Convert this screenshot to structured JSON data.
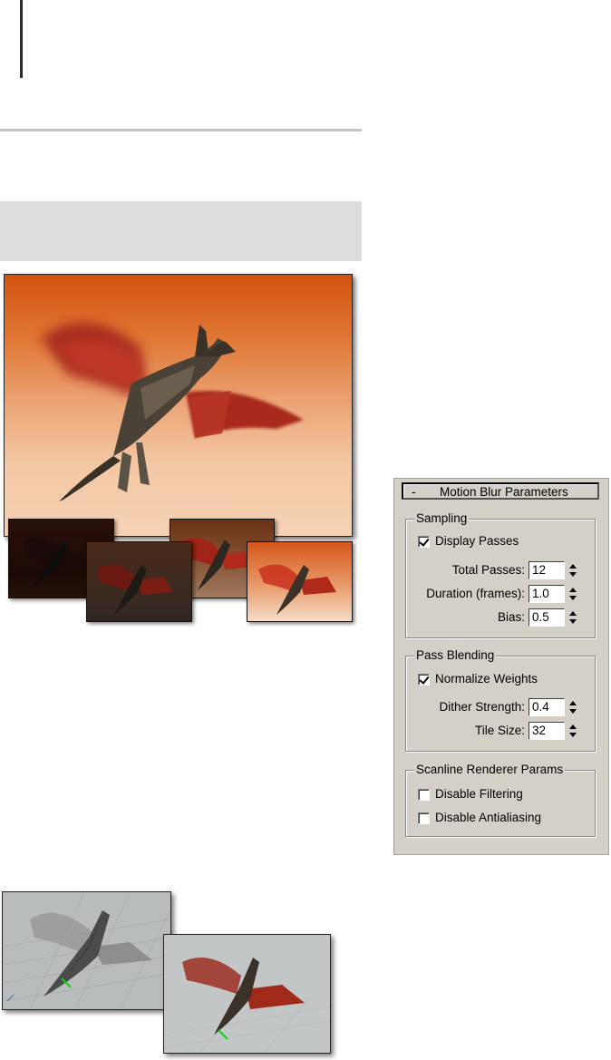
{
  "rollout": {
    "header_toggle": "-",
    "title": "Motion Blur Parameters",
    "sampling": {
      "label": "Sampling",
      "display_passes": {
        "label": "Display Passes",
        "checked": true
      },
      "total_passes": {
        "label": "Total Passes:",
        "value": "12"
      },
      "duration": {
        "label": "Duration (frames):",
        "value": "1.0"
      },
      "bias": {
        "label": "Bias:",
        "value": "0.5"
      }
    },
    "pass_blending": {
      "label": "Pass Blending",
      "normalize_weights": {
        "label": "Normalize Weights",
        "checked": true
      },
      "dither_strength": {
        "label": "Dither Strength:",
        "value": "0.4"
      },
      "tile_size": {
        "label": "Tile Size:",
        "value": "32"
      }
    },
    "scanline": {
      "label": "Scanline Renderer Params",
      "disable_filtering": {
        "label": "Disable Filtering",
        "checked": false
      },
      "disable_antialiasing": {
        "label": "Disable Antialiasing",
        "checked": false
      }
    }
  },
  "colors": {
    "panel_bg": "#d4d0c8",
    "sky_top": "#d4520f",
    "sky_bottom": "#f6d2b5",
    "viewport_bg": "#b9bcbc"
  }
}
